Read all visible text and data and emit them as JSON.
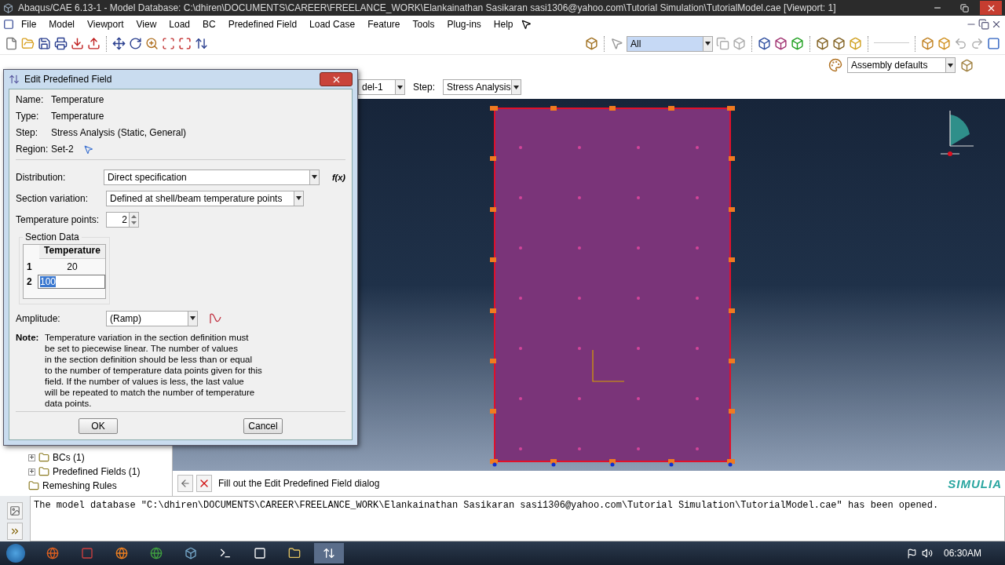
{
  "window": {
    "title": "Abaqus/CAE 6.13-1 - Model Database: C:\\dhiren\\DOCUMENTS\\CAREER\\FREELANCE_WORK\\Elankainathan Sasikaran sasi1306@yahoo.com\\Tutorial Simulation\\TutorialModel.cae [Viewport: 1]"
  },
  "menu_bar": {
    "items": [
      "File",
      "Model",
      "Viewport",
      "View",
      "Load",
      "BC",
      "Predefined Field",
      "Load Case",
      "Feature",
      "Tools",
      "Plug-ins",
      "Help"
    ]
  },
  "toolbar": {
    "selection_filter": "All",
    "render_style": "Assembly defaults"
  },
  "context_bar": {
    "model": "del-1",
    "step_label": "Step:",
    "step": "Stress Analysis"
  },
  "dialog": {
    "title": "Edit Predefined Field",
    "info": [
      {
        "label": "Name:",
        "value": "Temperature"
      },
      {
        "label": "Type:",
        "value": "Temperature"
      },
      {
        "label": "Step:",
        "value": "Stress Analysis (Static, General)"
      },
      {
        "label": "Region:",
        "value": "Set-2"
      }
    ],
    "distribution": {
      "label": "Distribution:",
      "value": "Direct specification",
      "function_button": "f(x)"
    },
    "section_variation": {
      "label": "Section variation:",
      "value": "Defined at shell/beam temperature points"
    },
    "temperature_points": {
      "label": "Temperature points:",
      "value": "2"
    },
    "section_data": {
      "title": "Section Data",
      "column": "Temperature",
      "rows": [
        {
          "index": "1",
          "value": "20",
          "editing": false
        },
        {
          "index": "2",
          "value": "100",
          "editing": true
        }
      ]
    },
    "amplitude": {
      "label": "Amplitude:",
      "value": "(Ramp)"
    },
    "note": {
      "label": "Note:",
      "lines": [
        "Temperature variation in the section definition must",
        "be set to piecewise linear. The number of values",
        "in the section definition should be less than or equal",
        "to the number of temperature data points given for this",
        "field.  If the number of values is less, the last value",
        "will be repeated to match the number of temperature",
        "data points."
      ]
    },
    "buttons": [
      "OK",
      "Cancel"
    ]
  },
  "model_tree": {
    "items": [
      {
        "label": "BCs (1)",
        "expanded": false
      },
      {
        "label": "Predefined Fields (1)",
        "expanded": false
      },
      {
        "label": "Remeshing Rules"
      }
    ]
  },
  "prompt": {
    "text": "Fill out the Edit Predefined Field dialog"
  },
  "brand": "SIMULIA",
  "message_area": {
    "text": "The model database \"C:\\dhiren\\DOCUMENTS\\CAREER\\FREELANCE_WORK\\Elankainathan Sasikaran sasi1306@yahoo.com\\Tutorial Simulation\\TutorialModel.cae\" has been opened."
  },
  "taskbar": {
    "clock": "06:30AM"
  }
}
